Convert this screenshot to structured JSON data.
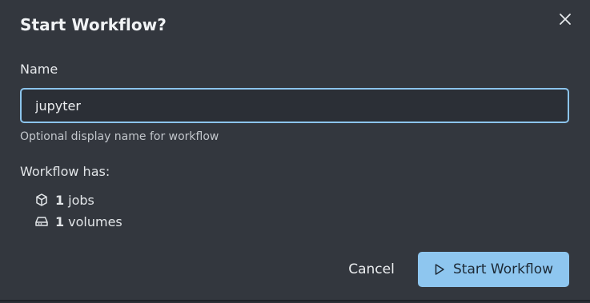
{
  "dialog": {
    "title": "Start Workflow?",
    "close_icon": "close-icon"
  },
  "form": {
    "name_label": "Name",
    "name_value": "jupyter",
    "helper_text": "Optional display name for workflow"
  },
  "summary": {
    "heading": "Workflow has:",
    "jobs": {
      "icon": "cube-icon",
      "count": "1",
      "label": "jobs"
    },
    "volumes": {
      "icon": "hard-drive-icon",
      "count": "1",
      "label": "volumes"
    }
  },
  "actions": {
    "cancel_label": "Cancel",
    "start_label": "Start Workflow",
    "start_icon": "play-icon"
  },
  "colors": {
    "dialog_bg": "#33373e",
    "input_border": "#8cc4ec",
    "primary_button": "#8ec6ef"
  }
}
